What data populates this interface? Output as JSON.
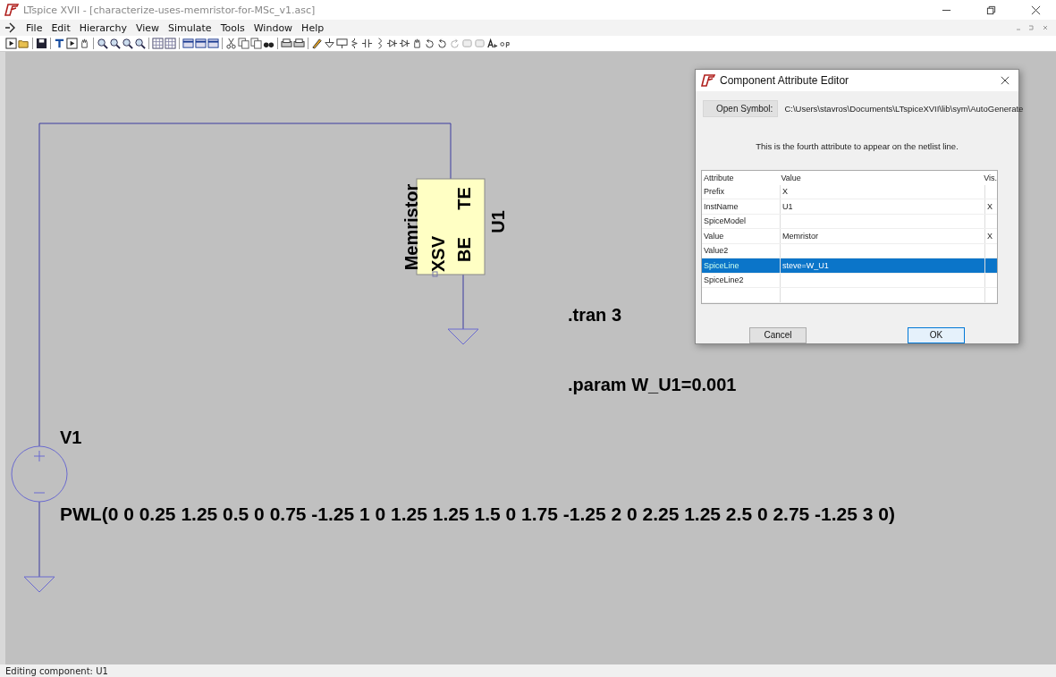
{
  "window": {
    "title": "LTspice XVII - [characterize-uses-memristor-for-MSc_v1.asc]"
  },
  "menu": [
    "File",
    "Edit",
    "Hierarchy",
    "View",
    "Simulate",
    "Tools",
    "Window",
    "Help"
  ],
  "schematic": {
    "component": {
      "value": "Memristor",
      "pins": [
        "TE",
        "XSV",
        "BE"
      ],
      "inst_name": "U1"
    },
    "directives": [
      ".tran 3",
      ".param W_U1=0.001"
    ],
    "source": {
      "name": "V1",
      "value": "PWL(0 0 0.25 1.25 0.5 0 0.75 -1.25 1 0 1.25 1.25 1.5 0 1.75 -1.25 2 0 2.25 1.25 2.5 0 2.75 -1.25 3 0)"
    }
  },
  "dialog": {
    "title": "Component Attribute Editor",
    "open_symbol_button": "Open Symbol:",
    "symbol_path": "C:\\Users\\stavros\\Documents\\LTspiceXVII\\lib\\sym\\AutoGenerate",
    "description": "This is the fourth attribute to appear on the netlist line.",
    "columns": [
      "Attribute",
      "Value",
      "Vis."
    ],
    "rows": [
      {
        "attribute": "Prefix",
        "value": "X",
        "vis": "",
        "selected": false
      },
      {
        "attribute": "InstName",
        "value": "U1",
        "vis": "X",
        "selected": false
      },
      {
        "attribute": "SpiceModel",
        "value": "",
        "vis": "",
        "selected": false
      },
      {
        "attribute": "Value",
        "value": "Memristor",
        "vis": "X",
        "selected": false
      },
      {
        "attribute": "Value2",
        "value": "",
        "vis": "",
        "selected": false
      },
      {
        "attribute": "SpiceLine",
        "value": "steve=W_U1",
        "vis": "",
        "selected": true
      },
      {
        "attribute": "SpiceLine2",
        "value": "",
        "vis": "",
        "selected": false
      }
    ],
    "buttons": [
      "Cancel",
      "OK"
    ]
  },
  "status_bar": "Editing component: U1"
}
